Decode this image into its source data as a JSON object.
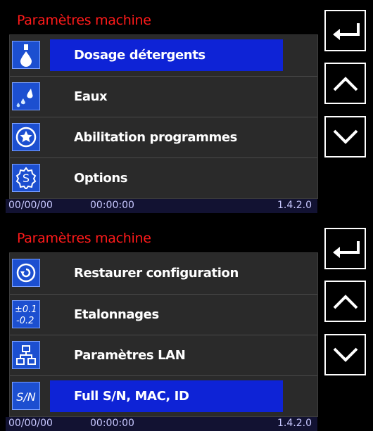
{
  "screens": [
    {
      "title": "Paramètres machine",
      "items": [
        {
          "label": "Dosage détergents",
          "icon": "drop-dosing-icon",
          "selected": true
        },
        {
          "label": "Eaux",
          "icon": "water-drops-icon",
          "selected": false
        },
        {
          "label": "Abilitation programmes",
          "icon": "star-circle-icon",
          "selected": false
        },
        {
          "label": "Options",
          "icon": "options-s-icon",
          "selected": false
        }
      ],
      "status": {
        "date": "00/00/00",
        "time": "00:00:00",
        "version": "1.4.2.0"
      }
    },
    {
      "title": "Paramètres machine",
      "items": [
        {
          "label": "Restaurer configuration",
          "icon": "restore-icon",
          "selected": false
        },
        {
          "label": "Etalonnages",
          "icon": "calibration-icon",
          "selected": false
        },
        {
          "label": "Paramètres LAN",
          "icon": "network-icon",
          "selected": false
        },
        {
          "label": "Full S/N, MAC, ID",
          "icon": "serial-number-icon",
          "selected": true
        }
      ],
      "status": {
        "date": "00/00/00",
        "time": "00:00:00",
        "version": "1.4.2.0"
      }
    }
  ],
  "icons": {
    "calibration_top": "±0.1",
    "calibration_bottom": "-0.2",
    "serial_text": "S/N",
    "options_letter": "S"
  },
  "colors": {
    "title": "#ff1a1a",
    "highlight": "#0e23d6",
    "icon_bg": "#1c4fd0",
    "panel": "#2a2a2a",
    "status_bar": "#121232"
  }
}
